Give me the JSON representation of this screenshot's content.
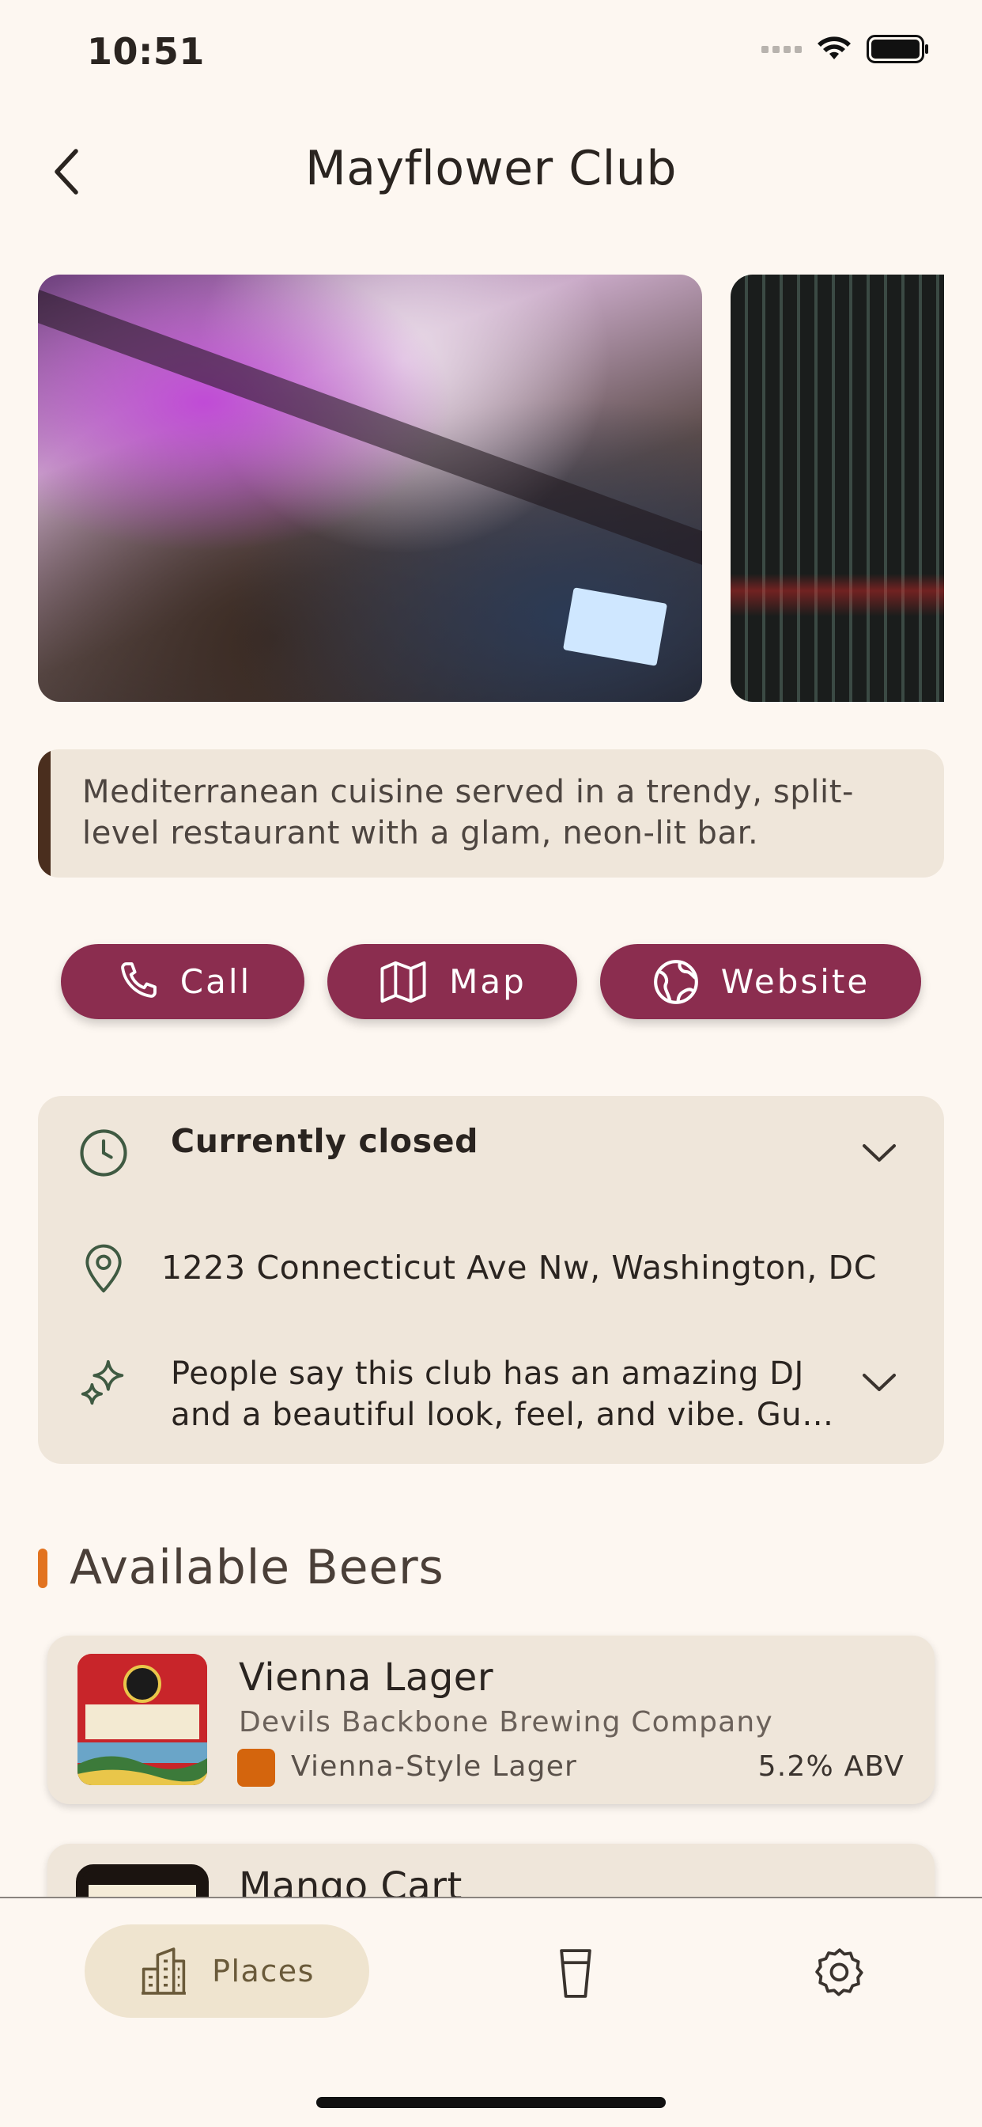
{
  "status_bar": {
    "time": "10:51"
  },
  "header": {
    "title": "Mayflower Club"
  },
  "description": "Mediterranean cuisine served in a trendy, split-level restaurant with a glam, neon-lit bar.",
  "actions": [
    {
      "label": "Call",
      "icon": "phone-icon"
    },
    {
      "label": "Map",
      "icon": "map-icon"
    },
    {
      "label": "Website",
      "icon": "globe-icon"
    }
  ],
  "info": {
    "hours": "Currently closed",
    "address": "1223 Connecticut Ave Nw, Washington, DC",
    "summary": "People say this club has an amazing DJ and a beautiful look, feel, and vibe. Gu…"
  },
  "beers_section": {
    "title": "Available Beers",
    "items": [
      {
        "name": "Vienna Lager",
        "brewery": "Devils Backbone Brewing Company",
        "style": "Vienna-Style Lager",
        "abv": "5.2% ABV",
        "style_color": "#d4650d"
      },
      {
        "name": "Mango Cart"
      }
    ]
  },
  "bottom_nav": {
    "places_label": "Places"
  },
  "colors": {
    "accent": "#8b2d4f",
    "background": "#fdf7f1",
    "card": "#efe6da",
    "section_marker": "#e27320"
  }
}
